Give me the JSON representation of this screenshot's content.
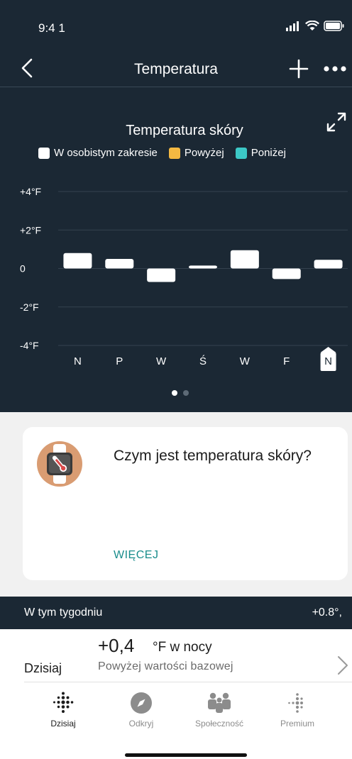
{
  "status": {
    "time": "9:4 1"
  },
  "nav": {
    "title": "Temperatura"
  },
  "chart_data": {
    "type": "bar",
    "title": "Temperatura skóry",
    "legend": [
      {
        "label": "W osobistym zakresie",
        "color": "#ffffff"
      },
      {
        "label": "Powyżej",
        "color": "#f4b942"
      },
      {
        "label": "Poniżej",
        "color": "#3cc8c6"
      }
    ],
    "legend_placement": "top",
    "y_ticks": [
      "+4°F",
      "+2°F",
      "0",
      "-2°F",
      "-4°F"
    ],
    "y_tick_values": [
      4,
      2,
      0,
      -2,
      -4
    ],
    "ylim": [
      -4,
      4
    ],
    "categories": [
      "N",
      "P",
      "W",
      "Ś",
      "W",
      "F",
      "N"
    ],
    "values": [
      0.8,
      0.5,
      -0.7,
      0.15,
      0.95,
      -0.55,
      0.45
    ],
    "highlighted_index": 6,
    "grid": true
  },
  "pager": {
    "count": 2,
    "active": 0
  },
  "card": {
    "question": "Czym jest temperatura skóry?",
    "more_label": "WIĘCEJ"
  },
  "week": {
    "label": "W tym tygodniu",
    "value": "+0.8°,"
  },
  "today": {
    "label": "Dzisiaj",
    "value": "+0,4",
    "unit": "°F w nocy",
    "subtitle": "Powyżej wartości bazowej"
  },
  "tabs": [
    {
      "label": "Dzisiaj",
      "icon": "fitbit-dots-icon",
      "active": true
    },
    {
      "label": "Odkryj",
      "icon": "compass-icon",
      "active": false
    },
    {
      "label": "Społeczność",
      "icon": "community-icon",
      "active": false
    },
    {
      "label": "Premium",
      "icon": "premium-dots-icon",
      "active": false
    }
  ],
  "colors": {
    "background": "#1b2834",
    "accent": "#1a8d8c"
  }
}
